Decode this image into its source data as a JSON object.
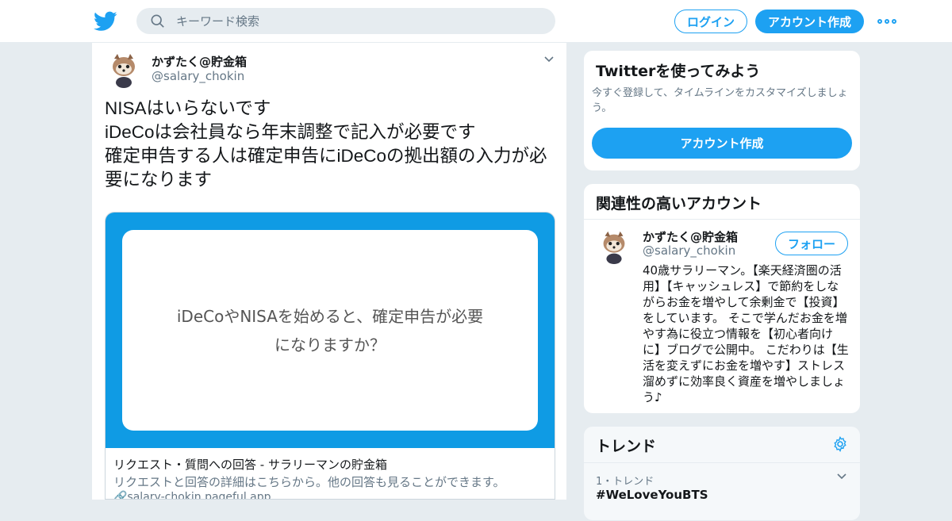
{
  "header": {
    "search_placeholder": "キーワード検索",
    "login_label": "ログイン",
    "signup_label": "アカウント作成"
  },
  "tweet": {
    "name": "かずたく@貯金箱",
    "handle": "@salary_chokin",
    "text": "NISAはいらないです\niDeCoは会社員なら年末調整で記入が必要です\n確定申告する人は確定申告にiDeCoの拠出額の入力が必要になります",
    "card": {
      "image_text": "iDeCoやNISAを始めると、確定申告が必要になりますか？",
      "title": "リクエスト・質問への回答 - サラリーマンの貯金箱",
      "description": "リクエストと回答の詳細はこちらから。他の回答も見ることができます。",
      "url": "🔗salary-chokin.pageful.app"
    }
  },
  "signup_panel": {
    "title": "Twitterを使ってみよう",
    "description": "今すぐ登録して、タイムラインをカスタマイズしましょう。",
    "button": "アカウント作成"
  },
  "related_panel": {
    "title": "関連性の高いアカウント",
    "account": {
      "name": "かずたく@貯金箱",
      "handle": "@salary_chokin",
      "follow_label": "フォロー",
      "bio": "40歳サラリーマン。【楽天経済圏の活用】【キャッシュレス】で節約をしながらお金を増やして余剰金で【投資】をしています。 そこで学んだお金を増やす為に役立つ情報を【初心者向けに】ブログで公開中。 こだわりは【生活を変えずにお金を増やす】ストレス溜めずに効率良く資産を増やしましょう♪"
    }
  },
  "trends_panel": {
    "title": "トレンド",
    "items": [
      {
        "meta": "1・トレンド",
        "name": "#WeLoveYouBTS"
      }
    ]
  },
  "colors": {
    "accent": "#1da1f2",
    "card_bg": "#0f9be4",
    "bg": "#e6ecf0"
  }
}
